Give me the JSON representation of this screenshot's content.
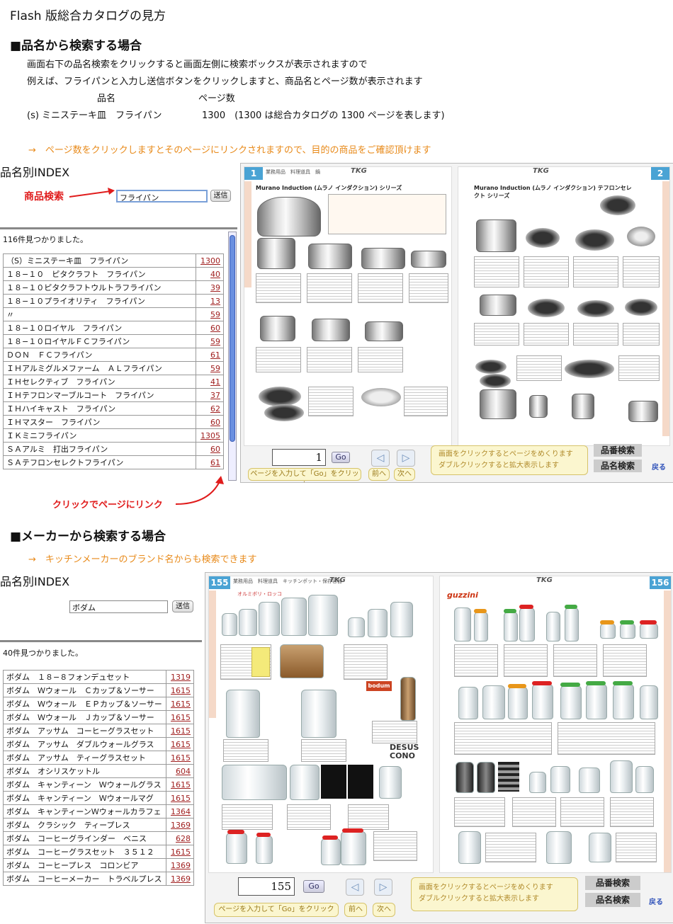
{
  "page_title": "Flash 版総合カタログの見方",
  "section1": {
    "heading": "■品名から検索する場合",
    "line1": "画面右下の品名検索をクリックすると画面左側に検索ボックスが表示されますので",
    "line2": "例えば、フライパンと入力し送信ボタンをクリックしますと、商品名とページ数が表示されます",
    "col_name": "品名",
    "col_page": "ページ数",
    "example_name": "(s) ミニステーキ皿　フライパン",
    "example_page": "1300　(1300 は総合カタログの 1300 ページを表します)",
    "note": "→　ページ数をクリックしますとそのページにリンクされますので、目的の商品をご確認頂けます",
    "callout_search": "商品検索",
    "callout_link": "クリックでページにリンク"
  },
  "panel1": {
    "title": "品名別INDEX",
    "search_value": "フライパン",
    "send_button": "送信",
    "found": "116件見つかりました。",
    "rows": [
      {
        "name": "（S）ミニステーキ皿　フライパン",
        "page": "1300"
      },
      {
        "name": "１８−１０　ピタクラフト　フライパン",
        "page": "40"
      },
      {
        "name": "１８−１０ピタクラフトウルトラフライパン",
        "page": "39"
      },
      {
        "name": "１８−１０プライオリティ　フライパン",
        "page": "13"
      },
      {
        "name": "〃",
        "page": "59"
      },
      {
        "name": "１８−１０ロイヤル　フライパン",
        "page": "60"
      },
      {
        "name": "１８−１０ロイヤルＦＣフライパン",
        "page": "59"
      },
      {
        "name": "ＤＯＮ　ＦＣフライパン",
        "page": "61"
      },
      {
        "name": "ＩＨアルミグルメファーム　ＡＬフライパン",
        "page": "59"
      },
      {
        "name": "ＩＨセレクティブ　フライパン",
        "page": "41"
      },
      {
        "name": "ＩＨテフロンマーブルコート　フライパン",
        "page": "37"
      },
      {
        "name": "ＩＨハイキャスト　フライパン",
        "page": "62"
      },
      {
        "name": "ＩＨマスター　フライパン",
        "page": "60"
      },
      {
        "name": "ＩＫミニフライパン",
        "page": "1305"
      },
      {
        "name": "ＳＡアルミ　打出フライパン",
        "page": "60"
      },
      {
        "name": "ＳＡテフロンセレクトフライパン",
        "page": "61"
      }
    ]
  },
  "viewer1": {
    "left_page_num": "1",
    "right_page_num": "2",
    "brand": "TKG",
    "left_series": "Murano Induction (ムラノ インダクション) シリーズ",
    "right_series": "Murano Induction (ムラノ インダクション) テフロンセレクト シリーズ",
    "page_input": "1",
    "go": "Go",
    "prev_arrow": "◁",
    "next_arrow": "▷",
    "hint_enter": "ページを入力して「Go」をクリック",
    "prev": "前へ",
    "next": "次へ",
    "hint_line1": "画面をクリックするとページをめくります",
    "hint_line2": "ダブルクリックすると拡大表示します",
    "code_search": "品番検索",
    "name_search": "品名検索",
    "back": "戻る"
  },
  "section2": {
    "heading": "■メーカーから検索する場合",
    "note": "→　キッチンメーカーのブランド名からも検索できます"
  },
  "panel2": {
    "title": "品名別INDEX",
    "search_value": "ボダム",
    "send_button": "送信",
    "found": "40件見つかりました。",
    "rows": [
      {
        "name": "ボダム　１８−８フォンデュセット",
        "page": "1319"
      },
      {
        "name": "ボダム　Ｗウォール　Ｃカップ＆ソーサー",
        "page": "1615"
      },
      {
        "name": "ボダム　Ｗウォール　ＥＰカップ＆ソーサー",
        "page": "1615"
      },
      {
        "name": "ボダム　Ｗウォール　Ｊカップ＆ソーサー",
        "page": "1615"
      },
      {
        "name": "ボダム　アッサム　コーヒーグラスセット",
        "page": "1615"
      },
      {
        "name": "ボダム　アッサム　ダブルウォールグラス",
        "page": "1615"
      },
      {
        "name": "ボダム　アッサム　ティーグラスセット",
        "page": "1615"
      },
      {
        "name": "ボダム　オシリスケットル",
        "page": "604"
      },
      {
        "name": "ボダム　キャンティーン　Ｗウォールグラス",
        "page": "1615"
      },
      {
        "name": "ボダム　キャンティーン　Ｗウォールマグ",
        "page": "1615"
      },
      {
        "name": "ボダム　キャンティーンＷウォールカラフェ",
        "page": "1364"
      },
      {
        "name": "ボダム　クラシック　ティープレス",
        "page": "1369"
      },
      {
        "name": "ボダム　コーヒーグラインダー　ベニス",
        "page": "628"
      },
      {
        "name": "ボダム　コーヒーグラスセット　３５１２",
        "page": "1615"
      },
      {
        "name": "ボダム　コーヒープレス　コロンビア",
        "page": "1369"
      },
      {
        "name": "ボダム　コーヒーメーカー　トラベルプレス",
        "page": "1369"
      }
    ]
  },
  "viewer2": {
    "left_page_num": "155",
    "right_page_num": "156",
    "brand": "TKG",
    "brand_left": "オルミボリ・ロッコ",
    "brand_right": "guzzini",
    "brand_bodum": "bodum",
    "brand_desus": "DESUS CONO",
    "page_input": "155",
    "go": "Go",
    "prev_arrow": "◁",
    "next_arrow": "▷",
    "hint_enter": "ページを入力して「Go」をクリック",
    "prev": "前へ",
    "next": "次へ",
    "hint_line1": "画面をクリックするとページをめくります",
    "hint_line2": "ダブルクリックすると拡大表示します",
    "code_search": "品番検索",
    "name_search": "品名検索",
    "back": "戻る"
  }
}
